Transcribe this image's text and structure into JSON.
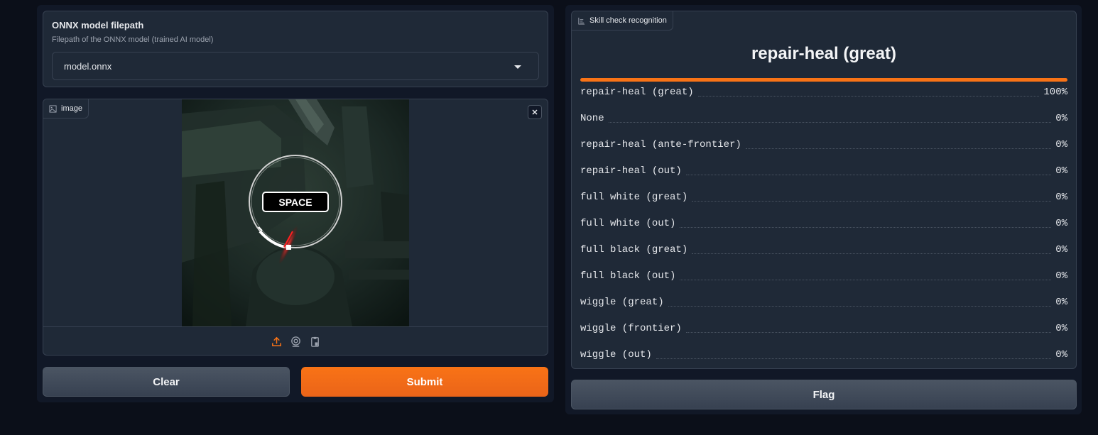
{
  "dropdown": {
    "label": "ONNX model filepath",
    "info": "Filepath of the ONNX model (trained AI model)",
    "value": "model.onnx"
  },
  "image_input": {
    "label": "image",
    "overlay_text": "SPACE"
  },
  "buttons": {
    "clear": "Clear",
    "submit": "Submit",
    "flag": "Flag"
  },
  "output": {
    "label": "Skill check recognition",
    "top_class": "repair-heal (great)",
    "top_confidence": 1.0,
    "confidences": [
      {
        "label": "repair-heal (great)",
        "value": "100%"
      },
      {
        "label": "None",
        "value": "0%"
      },
      {
        "label": "repair-heal (ante-frontier)",
        "value": "0%"
      },
      {
        "label": "repair-heal (out)",
        "value": "0%"
      },
      {
        "label": "full white (great)",
        "value": "0%"
      },
      {
        "label": "full white (out)",
        "value": "0%"
      },
      {
        "label": "full black (great)",
        "value": "0%"
      },
      {
        "label": "full black (out)",
        "value": "0%"
      },
      {
        "label": "wiggle (great)",
        "value": "0%"
      },
      {
        "label": "wiggle (frontier)",
        "value": "0%"
      },
      {
        "label": "wiggle (out)",
        "value": "0%"
      }
    ]
  },
  "colors": {
    "accent": "#f97316",
    "background": "#0b0f19",
    "panel": "#1f2937"
  },
  "icons": [
    "image-icon",
    "close-icon",
    "upload-icon",
    "webcam-icon",
    "clipboard-icon",
    "chevron-down-icon",
    "label-icon"
  ]
}
